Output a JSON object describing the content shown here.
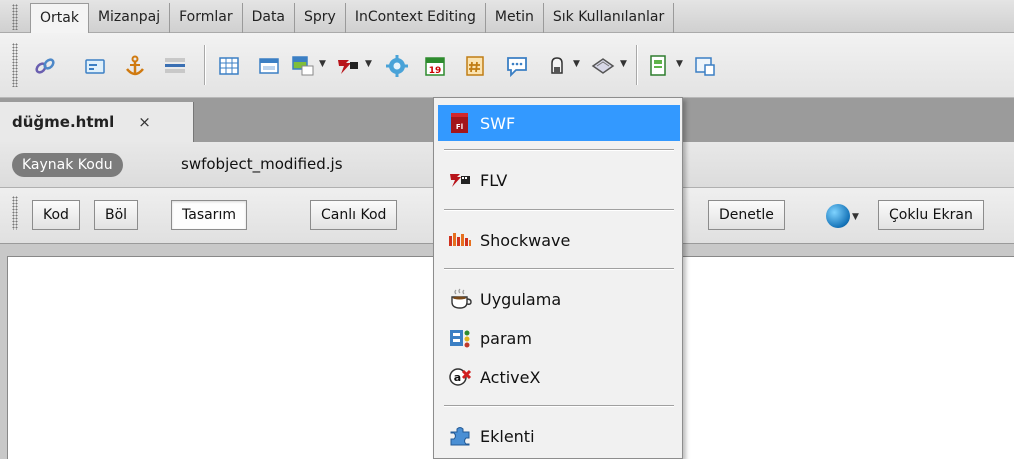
{
  "insert_panel": {
    "tabs": [
      {
        "label": "Ortak",
        "active": true
      },
      {
        "label": "Mizanpaj"
      },
      {
        "label": "Formlar"
      },
      {
        "label": "Data"
      },
      {
        "label": "Spry"
      },
      {
        "label": "InContext Editing"
      },
      {
        "label": "Metin"
      },
      {
        "label": "Sık Kullanılanlar"
      }
    ],
    "icons": [
      "hyperlink-icon",
      "email-link-icon",
      "named-anchor-icon",
      "horizontal-rule-icon",
      "table-icon",
      "insert-div-icon",
      "images-icon",
      "media-icon",
      "widget-icon",
      "date-icon",
      "server-side-include-icon",
      "comment-icon",
      "head-icon",
      "script-icon",
      "templates-icon",
      "tag-chooser-icon"
    ]
  },
  "document": {
    "tab_name": "düğme.html",
    "close_glyph": "×"
  },
  "related_files": {
    "source_code": "Kaynak Kodu",
    "file": "swfobject_modified.js"
  },
  "doc_toolbar": {
    "code": "Kod",
    "split": "Böl",
    "design": "Tasarım",
    "live_code": "Canlı Kod",
    "inspect": "Denetle",
    "multiscreen": "Çoklu Ekran"
  },
  "media_menu": {
    "items": [
      {
        "label": "SWF",
        "icon": "swf-icon",
        "selected": true
      },
      {
        "label": "FLV",
        "icon": "flv-icon"
      },
      {
        "label": "Shockwave",
        "icon": "shockwave-icon"
      },
      {
        "label": "Uygulama",
        "icon": "applet-icon"
      },
      {
        "label": "param",
        "icon": "param-icon"
      },
      {
        "label": "ActiveX",
        "icon": "activex-icon"
      },
      {
        "label": "Eklenti",
        "icon": "plugin-icon"
      }
    ]
  },
  "colors": {
    "selection": "#3399ff",
    "canvas": "#ffffff"
  }
}
